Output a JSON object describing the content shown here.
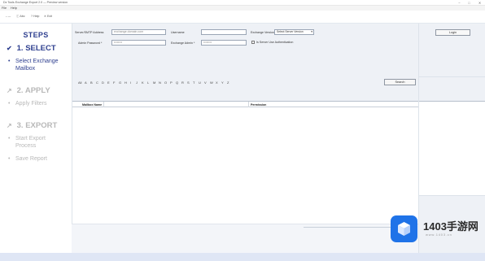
{
  "window": {
    "title": "Dx Tools Exchange Export 2.0 — Preview version",
    "min_glyph": "−",
    "max_glyph": "□",
    "close_glyph": "✕"
  },
  "menu": {
    "file": "File",
    "help": "Help"
  },
  "toolbar": {
    "back": "←—",
    "info": "ⓘ Abc",
    "help": "? Help",
    "exit": "✕ Exit"
  },
  "steps": {
    "title": "STEPS",
    "items": [
      {
        "icon": "✔",
        "label": "1. SELECT",
        "sub": [
          "Select Exchange",
          "Mailbox"
        ]
      },
      {
        "icon": "↗",
        "label": "2. APPLY",
        "sub": [
          "Apply Filters"
        ]
      },
      {
        "icon": "↗",
        "label": "3. EXPORT",
        "sub": [
          "Start Export",
          "Process",
          "Save Report"
        ]
      }
    ]
  },
  "form": {
    "server_label": "Server/SMTP Address",
    "server_value": "exchange.domain.com",
    "username_label": "Username",
    "username_value": "",
    "exchange_label": "Exchange Version",
    "exchange_value": "Select Server Version",
    "admin_label": "Admin Password *",
    "admin_value": "••••••••",
    "exch_admin_label": "Exchange Admin *",
    "exch_admin_value": "••••••••",
    "remember_label": "Is Server Use Authentication"
  },
  "filter": {
    "letters": [
      "All",
      "A",
      "B",
      "C",
      "D",
      "E",
      "F",
      "G",
      "H",
      "I",
      "J",
      "K",
      "L",
      "M",
      "N",
      "O",
      "P",
      "Q",
      "R",
      "S",
      "T",
      "U",
      "V",
      "W",
      "X",
      "Y",
      "Z"
    ],
    "search_label": "Search"
  },
  "login": {
    "label": "Login"
  },
  "grid": {
    "columns": [
      "Mailbox Name",
      "Permission"
    ]
  },
  "watermark": {
    "brand": "1403手游网",
    "url": "www.1403.cn"
  }
}
